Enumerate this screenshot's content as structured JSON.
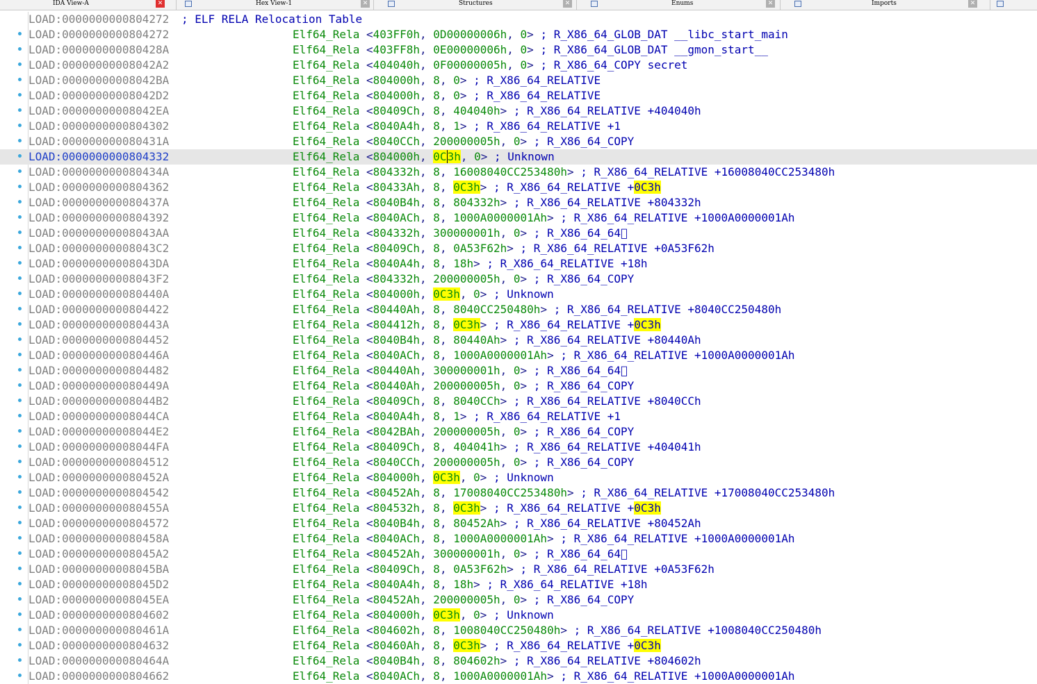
{
  "tabs": [
    {
      "label": "IDA View-A",
      "active": true
    },
    {
      "label": "Hex View-1",
      "active": false
    },
    {
      "label": "Structures",
      "active": false
    },
    {
      "label": "Enums",
      "active": false
    },
    {
      "label": "Imports",
      "active": false
    }
  ],
  "colors": {
    "highlight": "#ffff00",
    "address": "#808080",
    "current_address": "#1f3fc8",
    "mnemonic": "#0a8a0a",
    "comment": "#0000b0",
    "bullet": "#3aa7dc"
  },
  "header": {
    "address": "LOAD:0000000000804272",
    "comment": "; ELF RELA Relocation Table"
  },
  "keyword": "Elf64_Rela",
  "rows": [
    {
      "address": "LOAD:0000000000804272",
      "args": [
        "403FF0h",
        "0D00000006h",
        "0"
      ],
      "comment": "; R_X86_64_GLOB_DAT __libc_start_main"
    },
    {
      "address": "LOAD:000000000080428A",
      "args": [
        "403FF8h",
        "0E00000006h",
        "0"
      ],
      "comment": "; R_X86_64_GLOB_DAT __gmon_start__"
    },
    {
      "address": "LOAD:00000000008042A2",
      "args": [
        "404040h",
        "0F00000005h",
        "0"
      ],
      "comment": "; R_X86_64_COPY secret"
    },
    {
      "address": "LOAD:00000000008042BA",
      "args": [
        "804000h",
        "8",
        "0"
      ],
      "comment": "; R_X86_64_RELATIVE"
    },
    {
      "address": "LOAD:00000000008042D2",
      "args": [
        "804000h",
        "8",
        "0"
      ],
      "comment": "; R_X86_64_RELATIVE"
    },
    {
      "address": "LOAD:00000000008042EA",
      "args": [
        "80409Ch",
        "8",
        "404040h"
      ],
      "comment": "; R_X86_64_RELATIVE +404040h"
    },
    {
      "address": "LOAD:0000000000804302",
      "args": [
        "8040A4h",
        "8",
        "1"
      ],
      "comment": "; R_X86_64_RELATIVE +1"
    },
    {
      "address": "LOAD:000000000080431A",
      "args": [
        "8040CCh",
        "200000005h",
        "0"
      ],
      "comment": "; R_X86_64_COPY"
    },
    {
      "address": "LOAD:0000000000804332",
      "args": [
        "804000h",
        "0C3h",
        "0"
      ],
      "comment": "; Unknown",
      "current": true,
      "hl_arg": 1
    },
    {
      "address": "LOAD:000000000080434A",
      "args": [
        "804332h",
        "8",
        "16008040CC253480h"
      ],
      "comment": "; R_X86_64_RELATIVE +16008040CC253480h"
    },
    {
      "address": "LOAD:0000000000804362",
      "args": [
        "80433Ah",
        "8",
        "0C3h"
      ],
      "comment": "; R_X86_64_RELATIVE +",
      "comment_hl": "0C3h",
      "hl_arg": 2
    },
    {
      "address": "LOAD:000000000080437A",
      "args": [
        "8040B4h",
        "8",
        "804332h"
      ],
      "comment": "; R_X86_64_RELATIVE +804332h"
    },
    {
      "address": "LOAD:0000000000804392",
      "args": [
        "8040ACh",
        "8",
        "1000A0000001Ah"
      ],
      "comment": "; R_X86_64_RELATIVE +1000A0000001Ah"
    },
    {
      "address": "LOAD:00000000008043AA",
      "args": [
        "804332h",
        "300000001h",
        "0"
      ],
      "comment": "; R_X86_64_64\u0000"
    },
    {
      "address": "LOAD:00000000008043C2",
      "args": [
        "80409Ch",
        "8",
        "0A53F62h"
      ],
      "comment": "; R_X86_64_RELATIVE +0A53F62h"
    },
    {
      "address": "LOAD:00000000008043DA",
      "args": [
        "8040A4h",
        "8",
        "18h"
      ],
      "comment": "; R_X86_64_RELATIVE +18h"
    },
    {
      "address": "LOAD:00000000008043F2",
      "args": [
        "804332h",
        "200000005h",
        "0"
      ],
      "comment": "; R_X86_64_COPY"
    },
    {
      "address": "LOAD:000000000080440A",
      "args": [
        "804000h",
        "0C3h",
        "0"
      ],
      "comment": "; Unknown",
      "hl_arg": 1
    },
    {
      "address": "LOAD:0000000000804422",
      "args": [
        "80440Ah",
        "8",
        "8040CC250480h"
      ],
      "comment": "; R_X86_64_RELATIVE +8040CC250480h"
    },
    {
      "address": "LOAD:000000000080443A",
      "args": [
        "804412h",
        "8",
        "0C3h"
      ],
      "comment": "; R_X86_64_RELATIVE +",
      "comment_hl": "0C3h",
      "hl_arg": 2
    },
    {
      "address": "LOAD:0000000000804452",
      "args": [
        "8040B4h",
        "8",
        "80440Ah"
      ],
      "comment": "; R_X86_64_RELATIVE +80440Ah"
    },
    {
      "address": "LOAD:000000000080446A",
      "args": [
        "8040ACh",
        "8",
        "1000A0000001Ah"
      ],
      "comment": "; R_X86_64_RELATIVE +1000A0000001Ah"
    },
    {
      "address": "LOAD:0000000000804482",
      "args": [
        "80440Ah",
        "300000001h",
        "0"
      ],
      "comment": "; R_X86_64_64\u0000"
    },
    {
      "address": "LOAD:000000000080449A",
      "args": [
        "80440Ah",
        "200000005h",
        "0"
      ],
      "comment": "; R_X86_64_COPY"
    },
    {
      "address": "LOAD:00000000008044B2",
      "args": [
        "80409Ch",
        "8",
        "8040CCh"
      ],
      "comment": "; R_X86_64_RELATIVE +8040CCh"
    },
    {
      "address": "LOAD:00000000008044CA",
      "args": [
        "8040A4h",
        "8",
        "1"
      ],
      "comment": "; R_X86_64_RELATIVE +1"
    },
    {
      "address": "LOAD:00000000008044E2",
      "args": [
        "8042BAh",
        "200000005h",
        "0"
      ],
      "comment": "; R_X86_64_COPY"
    },
    {
      "address": "LOAD:00000000008044FA",
      "args": [
        "80409Ch",
        "8",
        "404041h"
      ],
      "comment": "; R_X86_64_RELATIVE +404041h"
    },
    {
      "address": "LOAD:0000000000804512",
      "args": [
        "8040CCh",
        "200000005h",
        "0"
      ],
      "comment": "; R_X86_64_COPY"
    },
    {
      "address": "LOAD:000000000080452A",
      "args": [
        "804000h",
        "0C3h",
        "0"
      ],
      "comment": "; Unknown",
      "hl_arg": 1
    },
    {
      "address": "LOAD:0000000000804542",
      "args": [
        "80452Ah",
        "8",
        "17008040CC253480h"
      ],
      "comment": "; R_X86_64_RELATIVE +17008040CC253480h"
    },
    {
      "address": "LOAD:000000000080455A",
      "args": [
        "804532h",
        "8",
        "0C3h"
      ],
      "comment": "; R_X86_64_RELATIVE +",
      "comment_hl": "0C3h",
      "hl_arg": 2
    },
    {
      "address": "LOAD:0000000000804572",
      "args": [
        "8040B4h",
        "8",
        "80452Ah"
      ],
      "comment": "; R_X86_64_RELATIVE +80452Ah"
    },
    {
      "address": "LOAD:000000000080458A",
      "args": [
        "8040ACh",
        "8",
        "1000A0000001Ah"
      ],
      "comment": "; R_X86_64_RELATIVE +1000A0000001Ah"
    },
    {
      "address": "LOAD:00000000008045A2",
      "args": [
        "80452Ah",
        "300000001h",
        "0"
      ],
      "comment": "; R_X86_64_64\u0000"
    },
    {
      "address": "LOAD:00000000008045BA",
      "args": [
        "80409Ch",
        "8",
        "0A53F62h"
      ],
      "comment": "; R_X86_64_RELATIVE +0A53F62h"
    },
    {
      "address": "LOAD:00000000008045D2",
      "args": [
        "8040A4h",
        "8",
        "18h"
      ],
      "comment": "; R_X86_64_RELATIVE +18h"
    },
    {
      "address": "LOAD:00000000008045EA",
      "args": [
        "80452Ah",
        "200000005h",
        "0"
      ],
      "comment": "; R_X86_64_COPY"
    },
    {
      "address": "LOAD:0000000000804602",
      "args": [
        "804000h",
        "0C3h",
        "0"
      ],
      "comment": "; Unknown",
      "hl_arg": 1
    },
    {
      "address": "LOAD:000000000080461A",
      "args": [
        "804602h",
        "8",
        "1008040CC250480h"
      ],
      "comment": "; R_X86_64_RELATIVE +1008040CC250480h"
    },
    {
      "address": "LOAD:0000000000804632",
      "args": [
        "80460Ah",
        "8",
        "0C3h"
      ],
      "comment": "; R_X86_64_RELATIVE +",
      "comment_hl": "0C3h",
      "hl_arg": 2
    },
    {
      "address": "LOAD:000000000080464A",
      "args": [
        "8040B4h",
        "8",
        "804602h"
      ],
      "comment": "; R_X86_64_RELATIVE +804602h"
    },
    {
      "address": "LOAD:0000000000804662",
      "args": [
        "8040ACh",
        "8",
        "1000A0000001Ah"
      ],
      "comment": "; R_X86_64_RELATIVE +1000A0000001Ah"
    }
  ]
}
